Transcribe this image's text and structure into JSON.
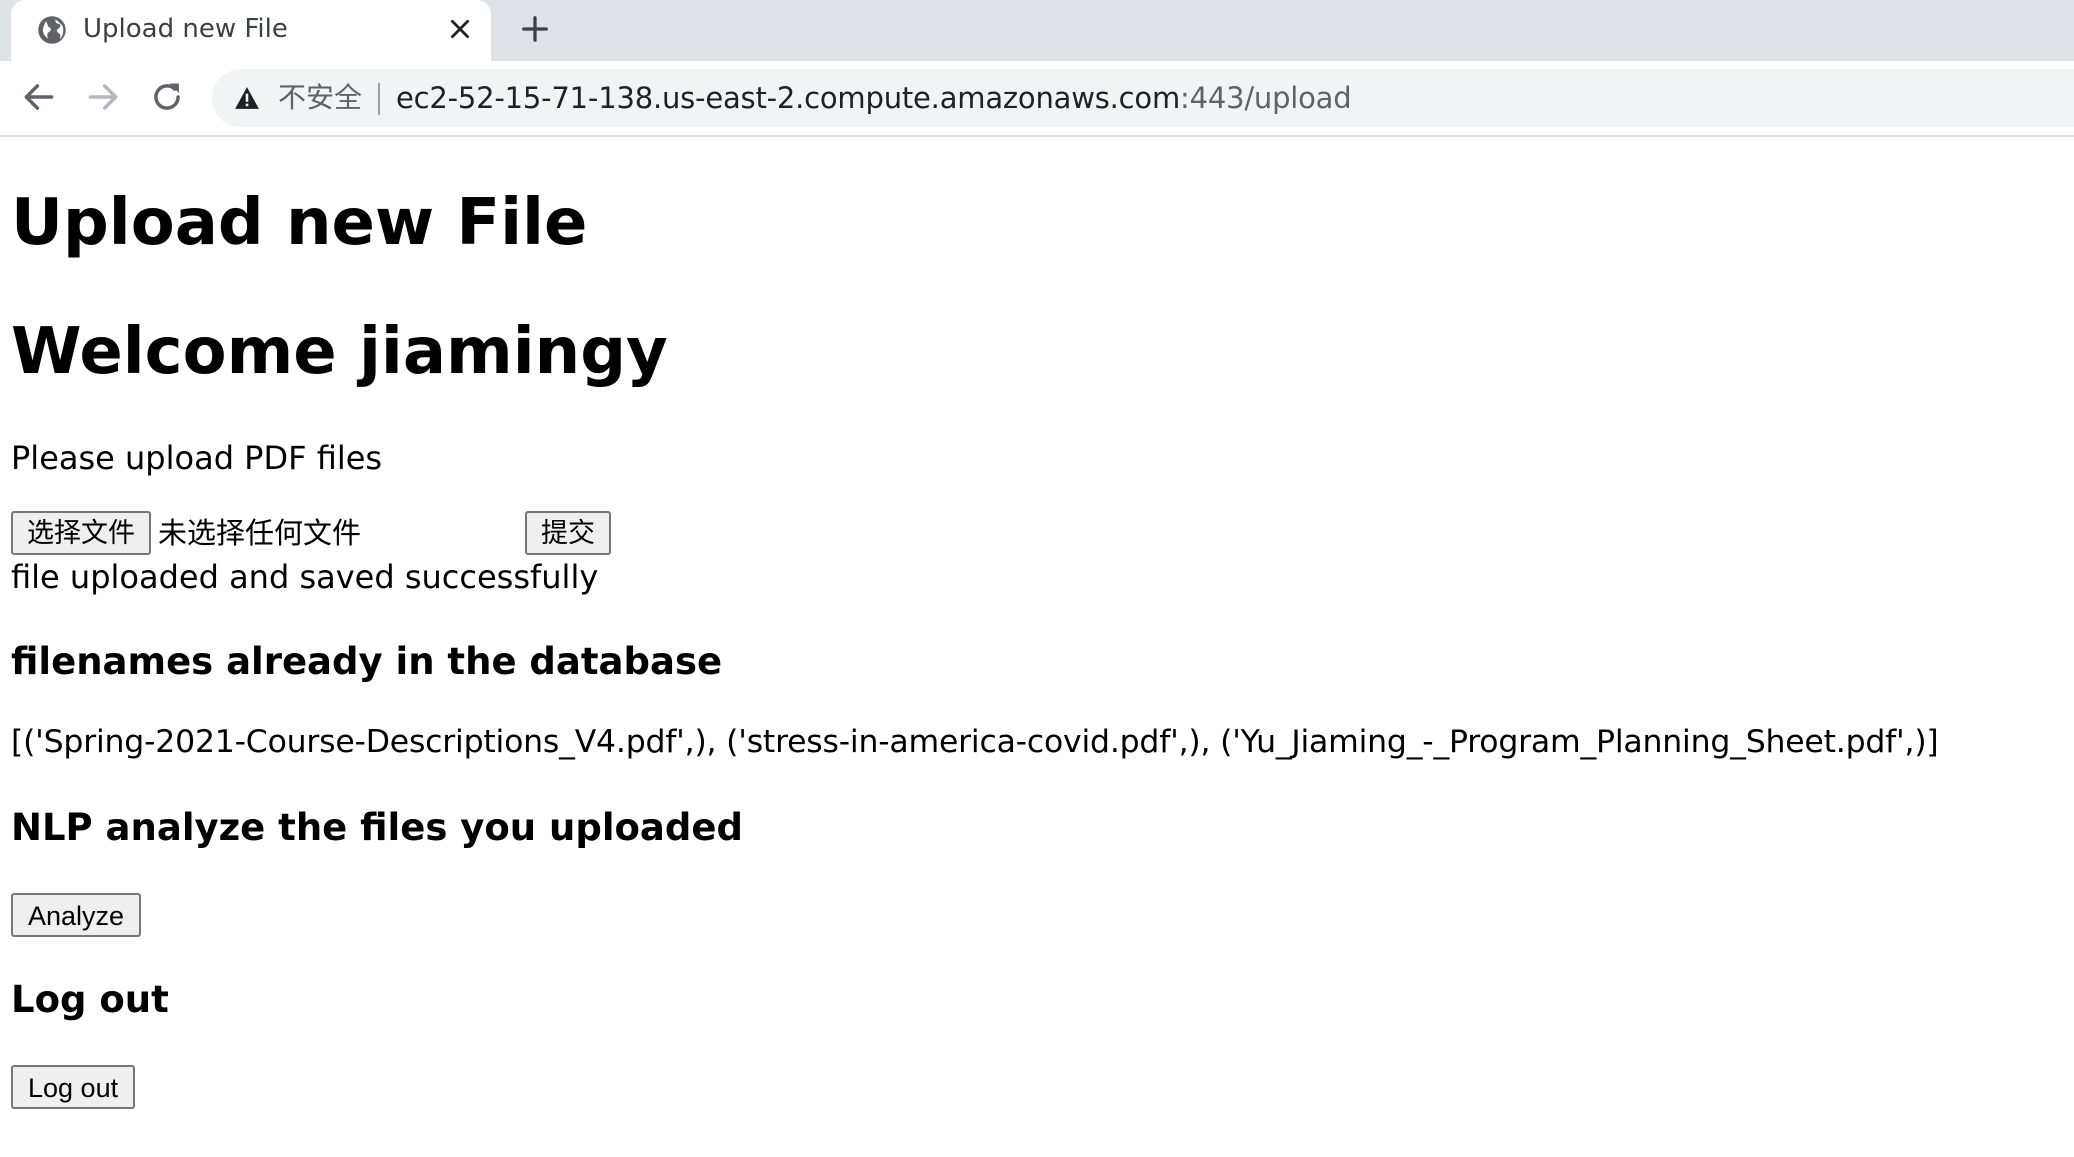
{
  "browser": {
    "tab_title": "Upload new File",
    "security_label": "不安全",
    "url_host": "ec2-52-15-71-138.us-east-2.compute.amazonaws.com",
    "url_rest": ":443/upload"
  },
  "page": {
    "heading": "Upload new File",
    "welcome": "Welcome jiamingy",
    "instruction": "Please upload PDF files",
    "file_input": {
      "choose_label": "选择文件",
      "status": "未选择任何文件"
    },
    "submit_label": "提交",
    "upload_message": "file uploaded and saved successfully",
    "db_heading": "filenames already in the database",
    "db_filenames": "[('Spring-2021-Course-Descriptions_V4.pdf',), ('stress-in-america-covid.pdf',), ('Yu_Jiaming_-_Program_Planning_Sheet.pdf',)]",
    "nlp_heading": "NLP analyze the files you uploaded",
    "analyze_label": "Analyze",
    "logout_heading": "Log out",
    "logout_label": "Log out"
  },
  "icons": {
    "tab_favicon": "globe-icon",
    "tab_close": "close-icon",
    "new_tab": "plus-icon",
    "back": "arrow-left-icon",
    "forward": "arrow-right-icon",
    "reload": "reload-icon",
    "security": "warning-triangle-icon"
  },
  "colors": {
    "tabstrip_bg": "#dee1e6",
    "omnibox_bg": "#f1f3f4",
    "button_bg": "#efefef"
  }
}
